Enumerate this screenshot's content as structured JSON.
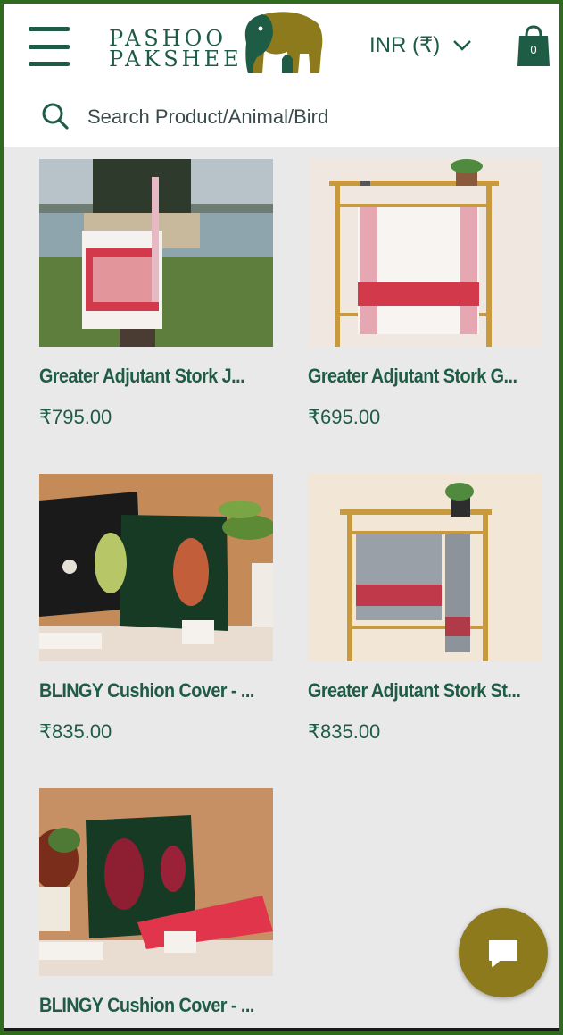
{
  "header": {
    "logo_line1": "PASHOO",
    "logo_line2": "PAKSHEE",
    "currency": "INR (₹)",
    "cart_count": "0"
  },
  "search": {
    "placeholder": "Search Product/Animal/Bird"
  },
  "products": [
    {
      "name": "Greater Adjutant Stork J...",
      "price": "₹795.00"
    },
    {
      "name": "Greater Adjutant Stork G...",
      "price": "₹695.00"
    },
    {
      "name": "BLINGY Cushion Cover - ...",
      "price": "₹835.00"
    },
    {
      "name": "Greater Adjutant Stork St...",
      "price": "₹835.00"
    },
    {
      "name": "BLINGY Cushion Cover - ...",
      "price": ""
    }
  ],
  "colors": {
    "brand": "#1f5c45",
    "chat": "#8d7a1c",
    "background": "#e9e9e9"
  },
  "icons": [
    "menu-icon",
    "chevron-down-icon",
    "cart-icon",
    "search-icon",
    "chat-icon"
  ]
}
